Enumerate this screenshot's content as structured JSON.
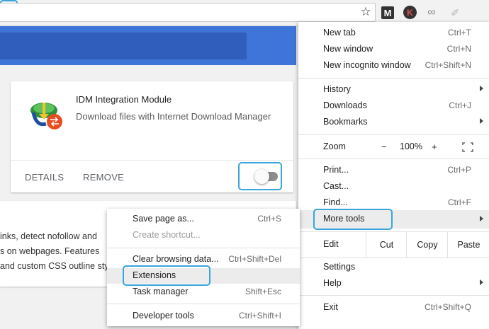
{
  "toolbar": {
    "star_glyph": "☆",
    "ext_m": "M",
    "ext_k": "K",
    "ext_link": "∞",
    "ext_pencil": "✐"
  },
  "extension_card": {
    "title": "IDM Integration Module",
    "description": "Download files with Internet Download Manager",
    "details_label": "DETAILS",
    "remove_label": "REMOVE",
    "toggle_enabled": false
  },
  "second_card": {
    "lines": [
      "inks, detect nofollow and",
      "s on webpages. Features",
      "and custom CSS outline sty"
    ]
  },
  "main_menu": {
    "new_tab": {
      "label": "New tab",
      "shortcut": "Ctrl+T"
    },
    "new_window": {
      "label": "New window",
      "shortcut": "Ctrl+N"
    },
    "new_incognito": {
      "label": "New incognito window",
      "shortcut": "Ctrl+Shift+N"
    },
    "history": {
      "label": "History"
    },
    "downloads": {
      "label": "Downloads",
      "shortcut": "Ctrl+J"
    },
    "bookmarks": {
      "label": "Bookmarks"
    },
    "zoom": {
      "label": "Zoom",
      "minus": "−",
      "value": "100%",
      "plus": "+"
    },
    "print": {
      "label": "Print...",
      "shortcut": "Ctrl+P"
    },
    "cast": {
      "label": "Cast..."
    },
    "find": {
      "label": "Find...",
      "shortcut": "Ctrl+F"
    },
    "more_tools": {
      "label": "More tools"
    },
    "edit": {
      "label": "Edit",
      "cut": "Cut",
      "copy": "Copy",
      "paste": "Paste"
    },
    "settings": {
      "label": "Settings"
    },
    "help": {
      "label": "Help"
    },
    "exit": {
      "label": "Exit",
      "shortcut": "Ctrl+Shift+Q"
    }
  },
  "more_tools_menu": {
    "save_page": {
      "label": "Save page as...",
      "shortcut": "Ctrl+S"
    },
    "create_shortcut": {
      "label": "Create shortcut..."
    },
    "clear_browsing": {
      "label": "Clear browsing data...",
      "shortcut": "Ctrl+Shift+Del"
    },
    "extensions": {
      "label": "Extensions"
    },
    "task_manager": {
      "label": "Task manager",
      "shortcut": "Shift+Esc"
    },
    "developer_tools": {
      "label": "Developer tools",
      "shortcut": "Ctrl+Shift+I"
    }
  },
  "colors": {
    "header_blue": "#3f74d8",
    "highlight_outline": "#3aa5dd"
  }
}
